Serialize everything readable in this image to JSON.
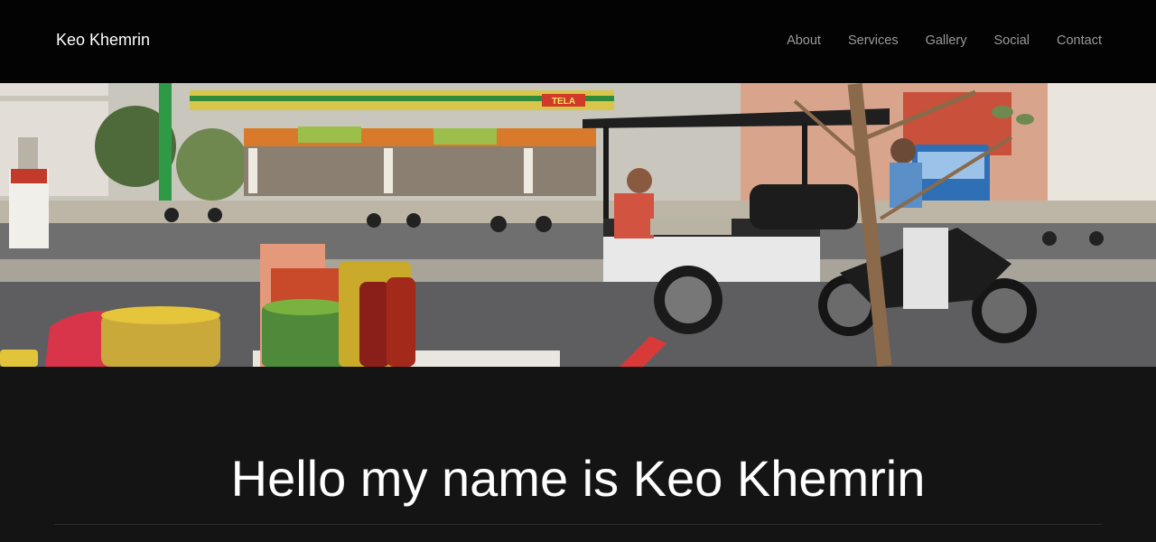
{
  "navbar": {
    "brand": "Keo Khemrin",
    "links": [
      "About",
      "Services",
      "Gallery",
      "Social",
      "Contact"
    ]
  },
  "hero": {
    "station_sign": "TELA"
  },
  "main": {
    "headline": "Hello my name is Keo Khemrin"
  },
  "colors": {
    "navbar_bg": "#030303",
    "page_bg": "#141414",
    "brand_text": "#ffffff",
    "nav_link": "#9a9a9a",
    "headline": "#ffffff"
  }
}
